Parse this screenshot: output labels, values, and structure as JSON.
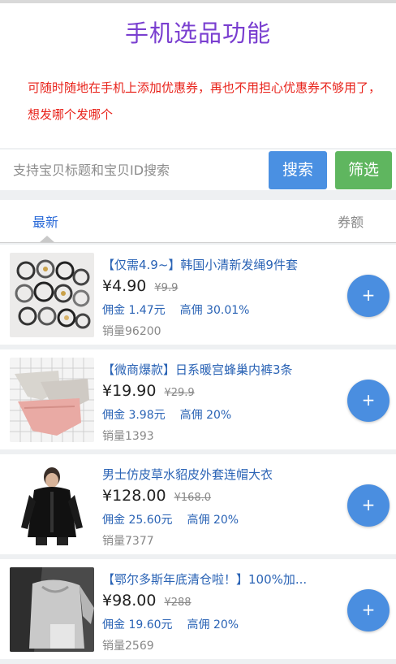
{
  "banner": {
    "title": "手机选品功能",
    "description": "可随时随地在手机上添加优惠券，再也不用担心优惠券不够用了，想发哪个发哪个"
  },
  "search": {
    "placeholder": "支持宝贝标题和宝贝ID搜索",
    "search_label": "搜索",
    "filter_label": "筛选"
  },
  "tabs": {
    "latest": "最新",
    "coupon_amount": "券额"
  },
  "products": [
    {
      "title": "【仅需4.9~】韩国小清新发绳9件套",
      "price": "¥4.90",
      "original_price": "¥9.9",
      "commission": "佣金 1.47元",
      "high_commission": "高佣 30.01%",
      "sales": "销量96200",
      "add_label": "+"
    },
    {
      "title": "【微商爆款】日系暖宫蜂巢内裤3条",
      "price": "¥19.90",
      "original_price": "¥29.9",
      "commission": "佣金 3.98元",
      "high_commission": "高佣 20%",
      "sales": "销量1393",
      "add_label": "+"
    },
    {
      "title": "男士仿皮草水貂皮外套连帽大衣",
      "price": "¥128.00",
      "original_price": "¥168.0",
      "commission": "佣金 25.60元",
      "high_commission": "高佣 20%",
      "sales": "销量7377",
      "add_label": "+"
    },
    {
      "title": "【鄂尔多斯年底清仓啦！】100%加...",
      "price": "¥98.00",
      "original_price": "¥288",
      "commission": "佣金 19.60元",
      "high_commission": "高佣 20%",
      "sales": "销量2569",
      "add_label": "+"
    }
  ],
  "colors": {
    "title_purple": "#7a3fd0",
    "notice_red": "#e8231b",
    "search_blue": "#4a90e2",
    "filter_green": "#5fb65f",
    "link_blue": "#2a63b5"
  }
}
